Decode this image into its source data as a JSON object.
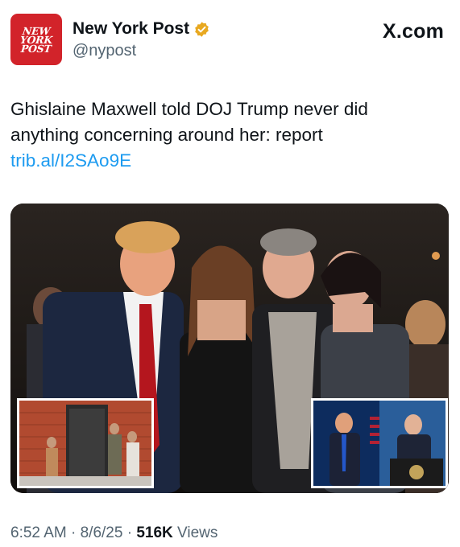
{
  "account": {
    "logo_lines": [
      "NEW",
      "YORK",
      "POST"
    ],
    "name": "New York Post",
    "handle": "@nypost",
    "verified": true,
    "badge_color": "#e8a820"
  },
  "platform": "X.com",
  "tweet": {
    "text": "Ghislaine Maxwell told DOJ Trump never did anything concerning around her: report ",
    "link": "trib.al/I2SAo9E"
  },
  "media": {
    "main_image": "four-people-party-photo",
    "inset_left": "building-entrance-photo",
    "inset_right": "press-briefing-photo"
  },
  "footer": {
    "time": "6:52 AM",
    "sep1": " · ",
    "date": "8/6/25",
    "sep2": " · ",
    "views_count": "516K",
    "views_label": " Views"
  },
  "colors": {
    "link": "#1d9bf0",
    "secondary_text": "#536471",
    "brand_red": "#d2232a"
  }
}
